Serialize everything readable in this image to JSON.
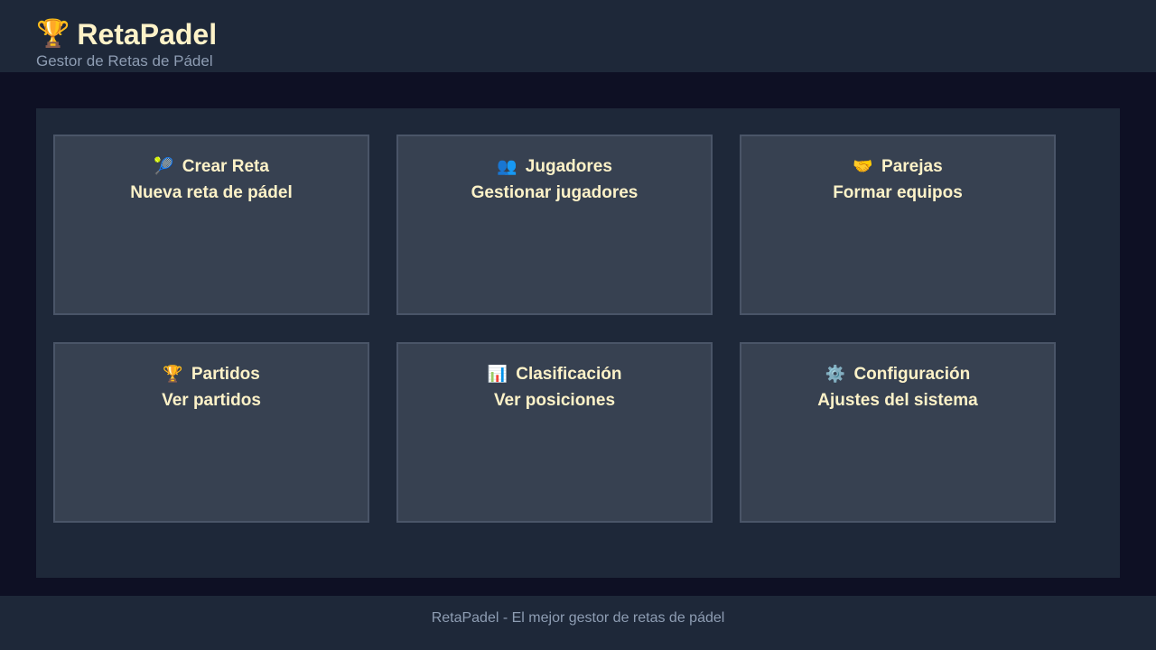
{
  "header": {
    "icon": "🏆",
    "icon_name": "trophy-icon",
    "title": "RetaPadel",
    "subtitle": "Gestor de Retas de Pádel"
  },
  "cards": [
    {
      "icon": "🎾",
      "title": "Crear Reta",
      "description": "Nueva reta de pádel"
    },
    {
      "icon": "👥",
      "title": "Jugadores",
      "description": "Gestionar jugadores"
    },
    {
      "icon": "🤝",
      "title": "Parejas",
      "description": "Formar equipos"
    },
    {
      "icon": "🏆",
      "title": "Partidos",
      "description": "Ver partidos"
    },
    {
      "icon": "📊",
      "title": "Clasificación",
      "description": "Ver posiciones"
    },
    {
      "icon": "⚙️",
      "title": "Configuración",
      "description": "Ajustes del sistema"
    }
  ],
  "footer": {
    "text": "RetaPadel - El mejor gestor de retas de pádel"
  },
  "colors": {
    "background": "#0e1024",
    "surface": "#1e2839",
    "card": "#374151",
    "card_border": "#4a5568",
    "accent_text": "#fdf2c8",
    "muted_text": "#8e9db3"
  }
}
